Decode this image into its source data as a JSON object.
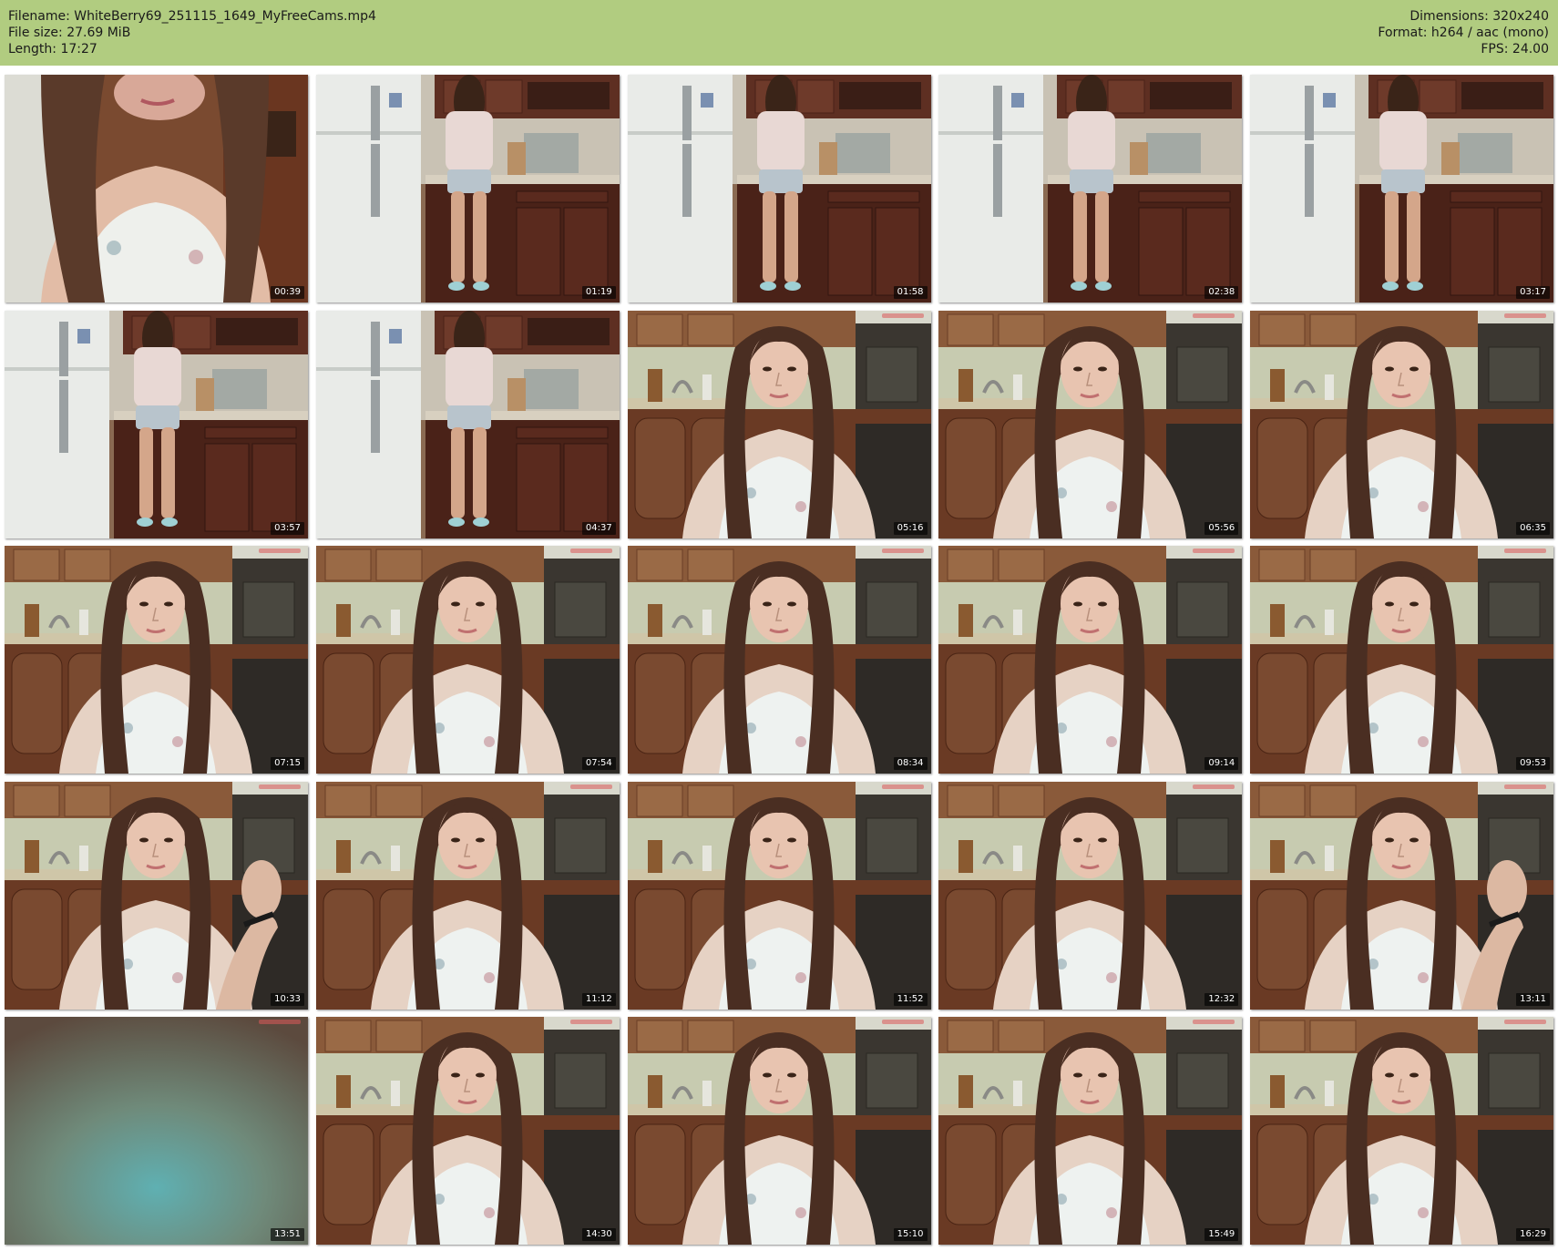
{
  "header": {
    "filename_line": "Filename: WhiteBerry69_251115_1649_MyFreeCams.mp4",
    "filesize_line": "File size: 27.69 MiB",
    "length_line": "Length: 17:27",
    "dimensions_line": "Dimensions: 320x240",
    "format_line": "Format: h264 / aac (mono)",
    "fps_line": "FPS: 24.00"
  },
  "colors": {
    "header_bg": "#b1cc80",
    "timestamp_bg": "#000000",
    "timestamp_text": "#ffffff"
  },
  "thumbnails": [
    {
      "time": "00:39",
      "scene": "closeup"
    },
    {
      "time": "01:19",
      "scene": "kitchen-back"
    },
    {
      "time": "01:58",
      "scene": "kitchen-back"
    },
    {
      "time": "02:38",
      "scene": "kitchen-back"
    },
    {
      "time": "03:17",
      "scene": "kitchen-back"
    },
    {
      "time": "03:57",
      "scene": "kitchen-back"
    },
    {
      "time": "04:37",
      "scene": "kitchen-back"
    },
    {
      "time": "05:16",
      "scene": "face"
    },
    {
      "time": "05:56",
      "scene": "face"
    },
    {
      "time": "06:35",
      "scene": "face"
    },
    {
      "time": "07:15",
      "scene": "face"
    },
    {
      "time": "07:54",
      "scene": "face"
    },
    {
      "time": "08:34",
      "scene": "face"
    },
    {
      "time": "09:14",
      "scene": "face"
    },
    {
      "time": "09:53",
      "scene": "face"
    },
    {
      "time": "10:33",
      "scene": "face-hand"
    },
    {
      "time": "11:12",
      "scene": "face"
    },
    {
      "time": "11:52",
      "scene": "face"
    },
    {
      "time": "12:32",
      "scene": "face"
    },
    {
      "time": "13:11",
      "scene": "face-hand"
    },
    {
      "time": "13:51",
      "scene": "blur"
    },
    {
      "time": "14:30",
      "scene": "face"
    },
    {
      "time": "15:10",
      "scene": "face"
    },
    {
      "time": "15:49",
      "scene": "face"
    },
    {
      "time": "16:29",
      "scene": "face"
    }
  ]
}
